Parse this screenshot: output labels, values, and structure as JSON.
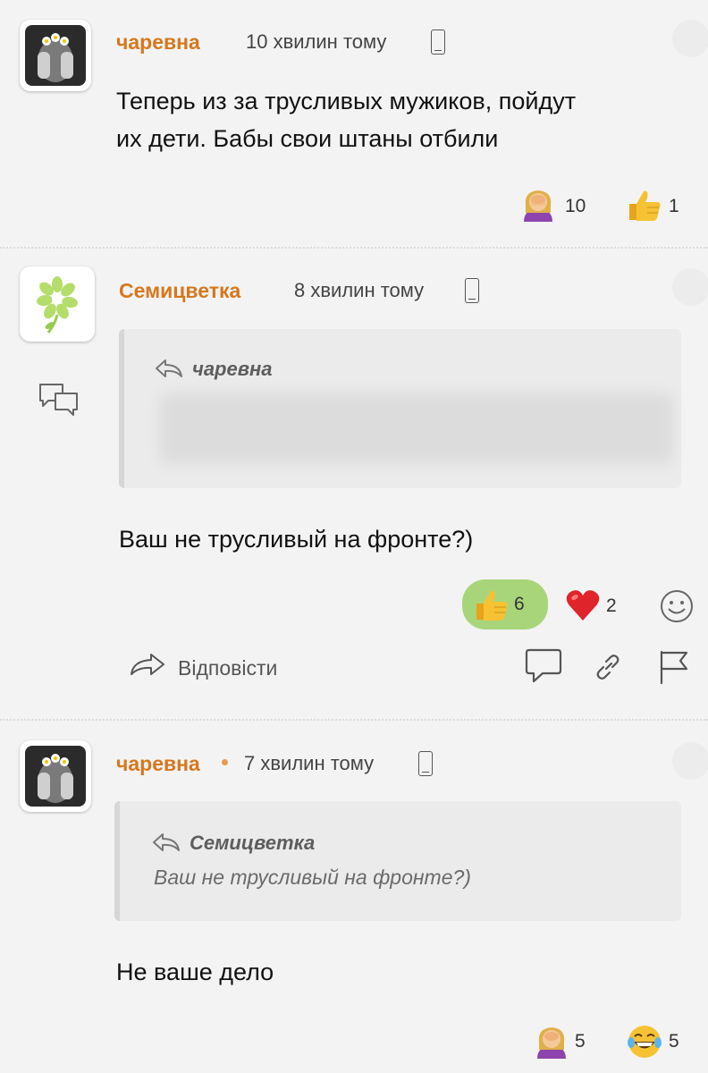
{
  "comments": [
    {
      "author": "чаревна",
      "time": "10 хвилин тому",
      "text_lines": [
        "Теперь из за трусливых мужиков, пойдут",
        "их дети. Бабы свои штаны отбили"
      ],
      "reactions": [
        {
          "icon": "facepalm-icon",
          "count": "10"
        },
        {
          "icon": "thumbs-up-icon",
          "count": "1"
        }
      ]
    },
    {
      "author": "Семицветка",
      "time": "8 хвилин тому",
      "quote_author": "чаревна",
      "text": "Ваш не трусливый на фронте?)",
      "reactions": [
        {
          "icon": "thumbs-up-icon",
          "count": "6",
          "active": true
        },
        {
          "icon": "heart-icon",
          "count": "2"
        }
      ],
      "actions": {
        "reply_label": "Відповісти"
      }
    },
    {
      "author": "чаревна",
      "time": "7 хвилин тому",
      "quote_author": "Семицветка",
      "quote_text": "Ваш не трусливый на фронте?)",
      "text": "Не ваше дело",
      "reactions": [
        {
          "icon": "facepalm-icon",
          "count": "5"
        },
        {
          "icon": "laughing-icon",
          "count": "5"
        }
      ]
    }
  ],
  "colors": {
    "author": "#d6781e",
    "like_active": "#a8d57a",
    "background": "#f3f3f3"
  }
}
